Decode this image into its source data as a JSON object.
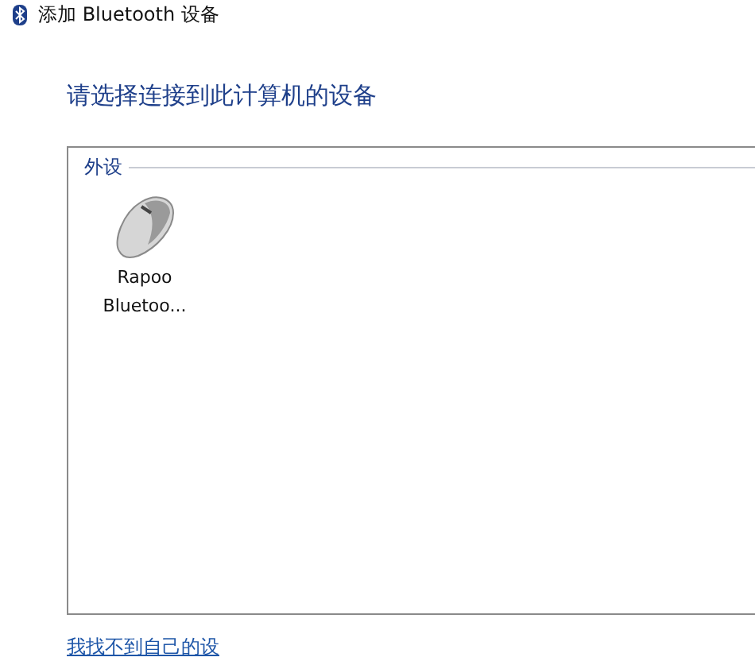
{
  "window": {
    "title": "添加 Bluetooth 设备"
  },
  "heading": "请选择连接到此计算机的设备",
  "group": {
    "label": "外设",
    "devices": [
      {
        "name_lines": [
          "Rapoo",
          "Bluetoo..."
        ],
        "kind": "mouse"
      }
    ]
  },
  "link": "我找不到自己的设"
}
